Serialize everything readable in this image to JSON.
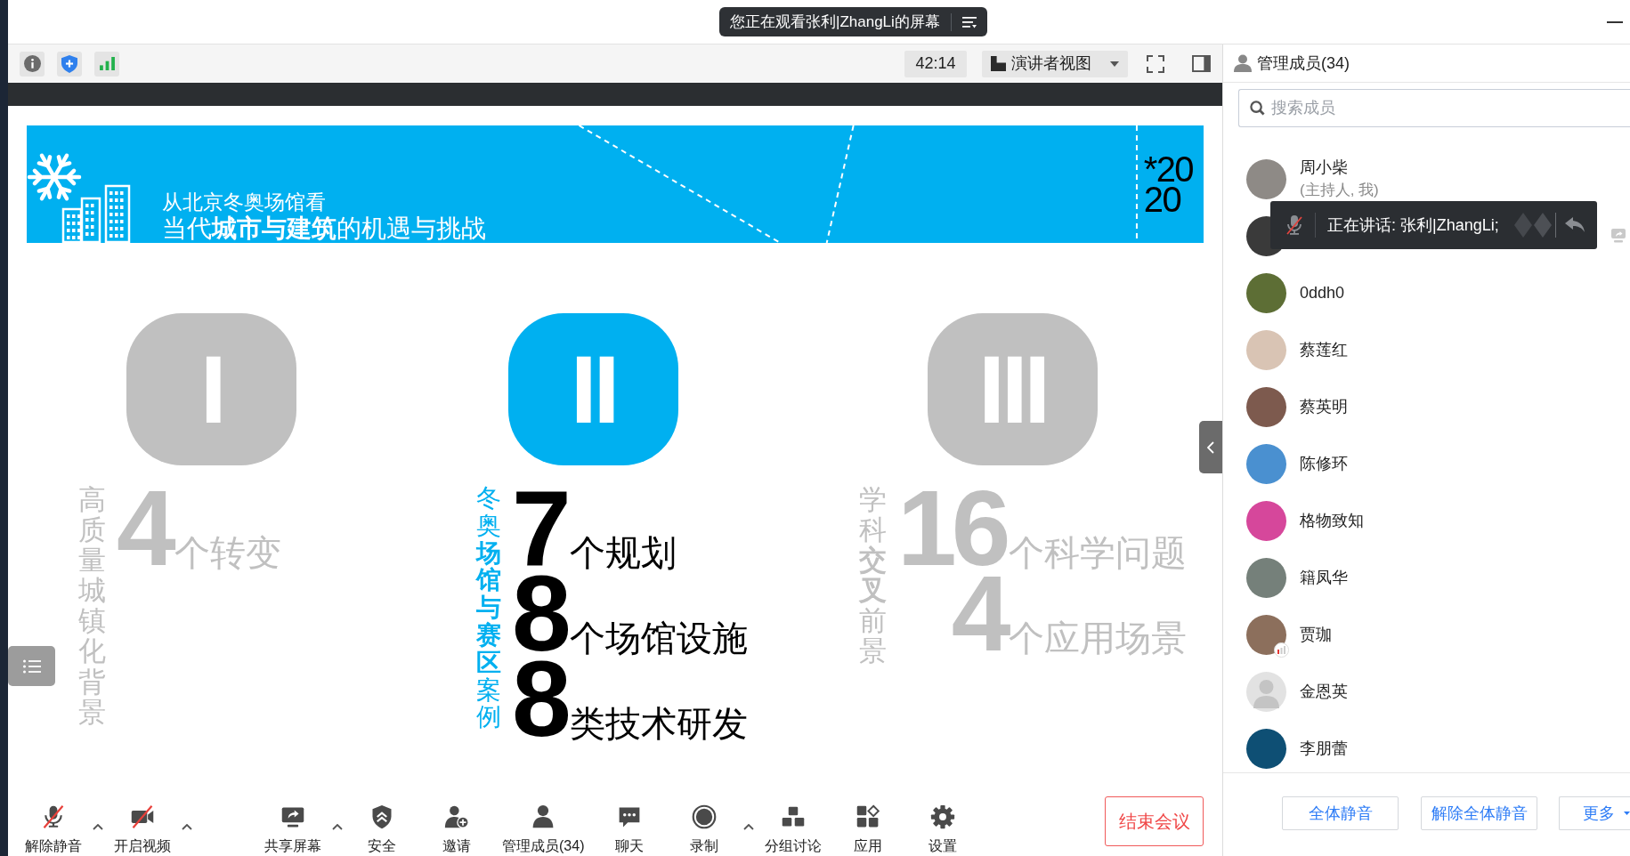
{
  "window": {
    "share_banner": "您正在观看张利|ZhangLi的屏幕"
  },
  "toolbar": {
    "timer": "42:14",
    "view_menu": "演讲者视图"
  },
  "slide": {
    "banner": {
      "subtitle": "从北京冬奥场馆看",
      "title": "当代**城市与建筑**的机遇与挑战",
      "logo": [
        "*20",
        "20"
      ]
    },
    "sections": [
      {
        "numeral": "I",
        "highlighted": false,
        "side_label": "高质量城镇化背景",
        "stats": [
          {
            "number": "4",
            "label": "个转变"
          }
        ]
      },
      {
        "numeral": "II",
        "highlighted": true,
        "side_label": "冬奥**场馆与赛区**案例",
        "stats": [
          {
            "number": "7",
            "label": "个规划"
          },
          {
            "number": "8",
            "label": "个场馆设施"
          },
          {
            "number": "8",
            "label": "类技术研发"
          }
        ]
      },
      {
        "numeral": "III",
        "highlighted": false,
        "side_label": "学科**交叉**前景",
        "stats": [
          {
            "number": "16",
            "label": "个科学问题"
          },
          {
            "number": "4",
            "label": "个应用场景"
          }
        ]
      }
    ]
  },
  "bottom_toolbar": {
    "items": [
      {
        "kind": "mic",
        "label": "解除静音",
        "off": true,
        "caret": true
      },
      {
        "kind": "video",
        "label": "开启视频",
        "off": true,
        "caret": true
      },
      {
        "kind": "share",
        "label": "共享屏幕",
        "off": false,
        "caret": true
      },
      {
        "kind": "security",
        "label": "安全",
        "off": false,
        "caret": false
      },
      {
        "kind": "invite",
        "label": "邀请",
        "off": false,
        "caret": false
      },
      {
        "kind": "participants",
        "label": "管理成员(34)",
        "off": false,
        "caret": false
      },
      {
        "kind": "chat",
        "label": "聊天",
        "off": false,
        "caret": false
      },
      {
        "kind": "record",
        "label": "录制",
        "off": false,
        "caret": true
      },
      {
        "kind": "breakout",
        "label": "分组讨论",
        "off": false,
        "caret": false
      },
      {
        "kind": "apps",
        "label": "应用",
        "off": false,
        "caret": false
      },
      {
        "kind": "settings",
        "label": "设置",
        "off": false,
        "caret": false
      }
    ],
    "end_button": "结束会议"
  },
  "participants_panel": {
    "title": "管理成员(34)",
    "search": {
      "placeholder": "搜索成员"
    },
    "members": [
      {
        "name": "周小柴",
        "role": "(主持人, 我)",
        "kind": "photo",
        "color": "#8e8a86",
        "audio": false,
        "sharing": false
      },
      {
        "kind": "photo",
        "color": "#3a3a3a",
        "audio": false,
        "sharing": true
      },
      {
        "name": "0ddh0",
        "kind": "photo",
        "color": "#5d6e35",
        "audio": false,
        "sharing": false
      },
      {
        "name": "蔡莲红",
        "kind": "photo",
        "color": "#d9c4b4",
        "audio": false,
        "sharing": false
      },
      {
        "name": "蔡英明",
        "kind": "photo",
        "color": "#7d5a4e",
        "audio": false,
        "sharing": false
      },
      {
        "name": "陈修环",
        "kind": "photo",
        "color": "#4a90d0",
        "audio": false,
        "sharing": false
      },
      {
        "name": "格物致知",
        "kind": "photo",
        "color": "#d6479b",
        "audio": false,
        "sharing": false
      },
      {
        "name": "籍凤华",
        "kind": "photo",
        "color": "#75807a",
        "audio": false,
        "sharing": false
      },
      {
        "name": "贾珈",
        "kind": "photo",
        "color": "#8c6f5c",
        "audio": true,
        "sharing": false
      },
      {
        "name": "金恩英",
        "kind": "default",
        "audio": false,
        "sharing": false
      },
      {
        "name": "李朋蕾",
        "kind": "photo",
        "color": "#0e4f74",
        "audio": false,
        "sharing": false
      }
    ],
    "speaking_toast": {
      "text": "正在讲话: 张利|ZhangLi;"
    },
    "buttons": [
      "全体静音",
      "解除全体静音"
    ],
    "more_button": "更多"
  }
}
